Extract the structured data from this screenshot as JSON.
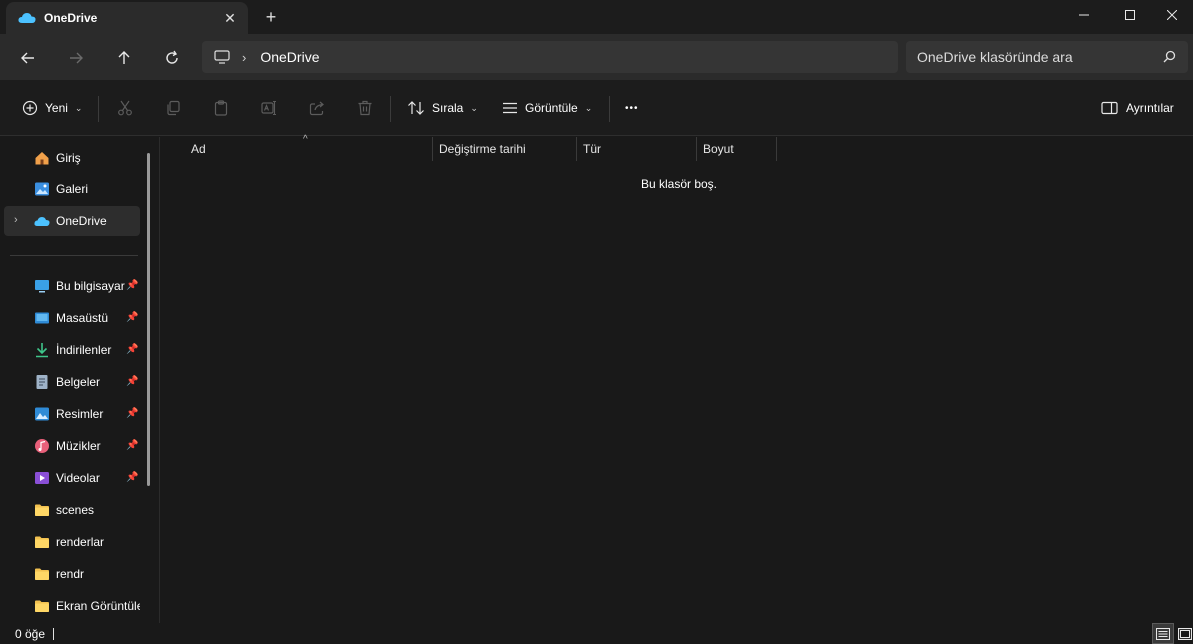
{
  "tab": {
    "title": "OneDrive",
    "close": "✕",
    "new_tab": "+"
  },
  "address": {
    "location": "OneDrive",
    "separator": "›"
  },
  "search": {
    "placeholder": "OneDrive klasöründe ara"
  },
  "toolbar": {
    "new_label": "Yeni",
    "sort_label": "Sırala",
    "view_label": "Görüntüle",
    "more_label": "•••",
    "details_label": "Ayrıntılar"
  },
  "sidebar": {
    "items": [
      {
        "label": "Giriş",
        "icon": "home-icon"
      },
      {
        "label": "Galeri",
        "icon": "gallery-icon"
      },
      {
        "label": "OneDrive",
        "icon": "onedrive-cloud-icon"
      },
      {
        "label": "Bu bilgisayar",
        "icon": "computer-icon"
      },
      {
        "label": "Masaüstü",
        "icon": "desktop-icon"
      },
      {
        "label": "İndirilenler",
        "icon": "download-icon"
      },
      {
        "label": "Belgeler",
        "icon": "documents-icon"
      },
      {
        "label": "Resimler",
        "icon": "pictures-icon"
      },
      {
        "label": "Müzikler",
        "icon": "music-icon"
      },
      {
        "label": "Videolar",
        "icon": "videos-icon"
      },
      {
        "label": "scenes",
        "icon": "folder-icon"
      },
      {
        "label": "renderlar",
        "icon": "folder-icon"
      },
      {
        "label": "rendr",
        "icon": "folder-icon"
      },
      {
        "label": "Ekran Görüntüleri",
        "icon": "folder-icon"
      }
    ]
  },
  "columns": [
    "Ad",
    "Değiştirme tarihi",
    "Tür",
    "Boyut"
  ],
  "content": {
    "empty_message": "Bu klasör boş."
  },
  "status": {
    "item_count": "0 öğe"
  },
  "colors": {
    "accent": "#4cc2ff",
    "folder": "#f2c150",
    "background": "#191919"
  }
}
